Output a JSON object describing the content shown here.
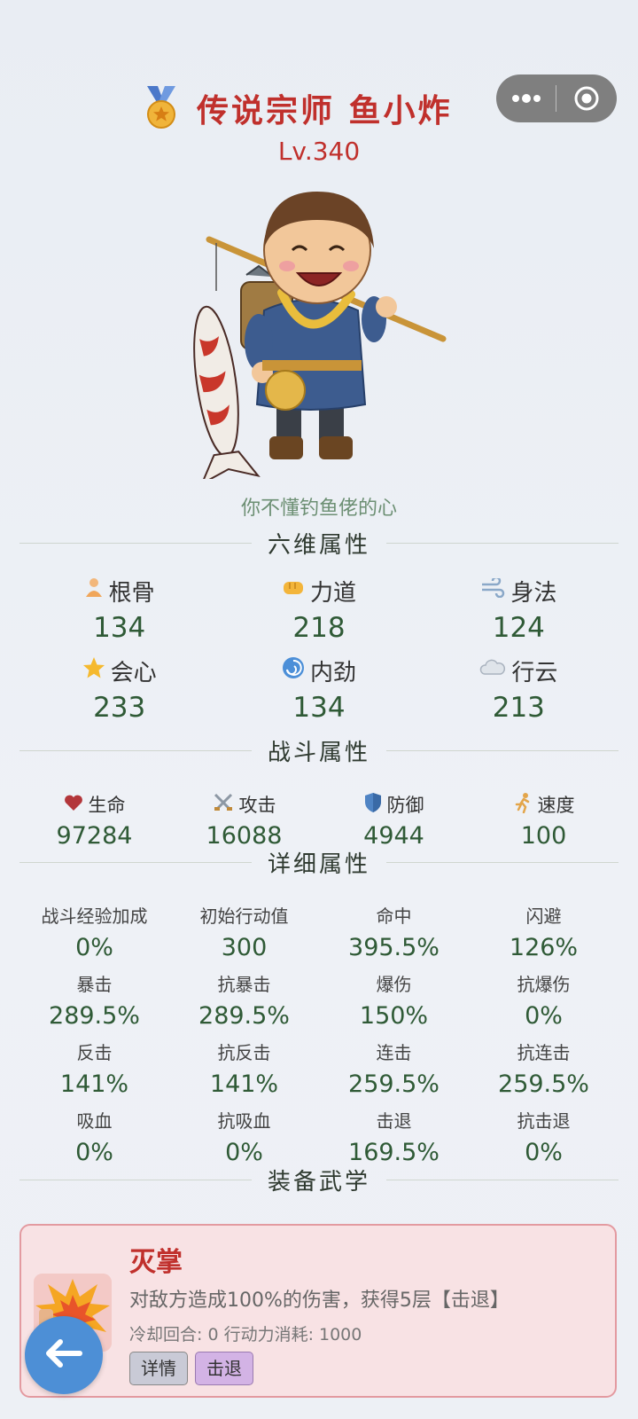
{
  "header": {
    "title": "传说宗师 鱼小炸",
    "level": "Lv.340",
    "motto": "你不懂钓鱼佬的心",
    "menu_icon": "more-dots-icon",
    "close_icon": "target-circle-icon"
  },
  "sections": {
    "six": "六维属性",
    "battle": "战斗属性",
    "detail": "详细属性",
    "skills": "装备武学"
  },
  "six_stats": [
    {
      "name": "根骨",
      "value": "134",
      "icon": "meditation-icon"
    },
    {
      "name": "力道",
      "value": "218",
      "icon": "fist-icon"
    },
    {
      "name": "身法",
      "value": "124",
      "icon": "wind-icon"
    },
    {
      "name": "会心",
      "value": "233",
      "icon": "star-icon"
    },
    {
      "name": "内劲",
      "value": "134",
      "icon": "swirl-icon"
    },
    {
      "name": "行云",
      "value": "213",
      "icon": "cloud-icon"
    }
  ],
  "battle_stats": [
    {
      "name": "生命",
      "value": "97284",
      "icon": "heart-icon"
    },
    {
      "name": "攻击",
      "value": "16088",
      "icon": "swords-icon"
    },
    {
      "name": "防御",
      "value": "4944",
      "icon": "shield-icon"
    },
    {
      "name": "速度",
      "value": "100",
      "icon": "runner-icon"
    }
  ],
  "detail_stats": [
    {
      "name": "战斗经验加成",
      "value": "0%"
    },
    {
      "name": "初始行动值",
      "value": "300"
    },
    {
      "name": "命中",
      "value": "395.5%"
    },
    {
      "name": "闪避",
      "value": "126%"
    },
    {
      "name": "暴击",
      "value": "289.5%"
    },
    {
      "name": "抗暴击",
      "value": "289.5%"
    },
    {
      "name": "爆伤",
      "value": "150%"
    },
    {
      "name": "抗爆伤",
      "value": "0%"
    },
    {
      "name": "反击",
      "value": "141%"
    },
    {
      "name": "抗反击",
      "value": "141%"
    },
    {
      "name": "连击",
      "value": "259.5%"
    },
    {
      "name": "抗连击",
      "value": "259.5%"
    },
    {
      "name": "吸血",
      "value": "0%"
    },
    {
      "name": "抗吸血",
      "value": "0%"
    },
    {
      "name": "击退",
      "value": "169.5%"
    },
    {
      "name": "抗击退",
      "value": "0%"
    }
  ],
  "skill": {
    "name": "灭掌",
    "description": "对敌方造成100%的伤害，获得5层【击退】",
    "meta": "冷却回合: 0  行动力消耗: 1000",
    "tags": [
      "详情",
      "击退"
    ]
  },
  "colors": {
    "title_red": "#c0302c",
    "value_green": "#2f5a36",
    "back_blue": "#4d8fd6"
  }
}
